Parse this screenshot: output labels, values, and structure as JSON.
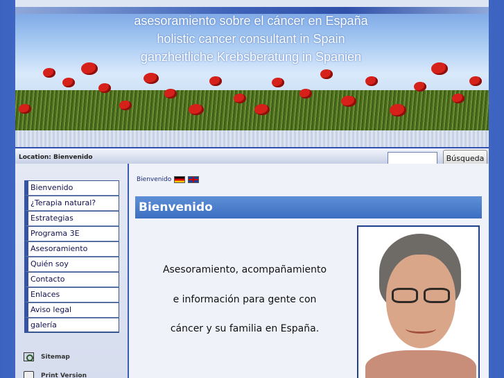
{
  "header": {
    "title_lines": [
      "asesoramiento sobre el cáncer en España",
      "holistic cancer consultant in Spain",
      "ganzheitliche Krebsberatung in Spanien"
    ]
  },
  "location": {
    "text": "Location: Bienvenido"
  },
  "search": {
    "value": "",
    "placeholder": "",
    "button_label": "Búsqueda"
  },
  "sidebar": {
    "items": [
      {
        "label": "Bienvenido"
      },
      {
        "label": "¿Terapia natural?"
      },
      {
        "label": "Estrategias"
      },
      {
        "label": "Programa 3E"
      },
      {
        "label": "Asesoramiento"
      },
      {
        "label": "Quién soy"
      },
      {
        "label": "Contacto"
      },
      {
        "label": "Enlaces"
      },
      {
        "label": "Aviso legal"
      },
      {
        "label": "galería"
      }
    ],
    "tools": [
      {
        "label": "Sitemap",
        "icon": "sitemap-icon"
      },
      {
        "label": "Print Version",
        "icon": "printer-icon"
      }
    ]
  },
  "main": {
    "breadcrumb": "Bienvenido",
    "flags": [
      "german-flag-icon",
      "uk-flag-icon"
    ],
    "heading": "Bienvenido",
    "intro_lines": [
      "Asesoramiento, acompañamiento",
      "e información para gente con",
      "cáncer y su familia en España."
    ]
  },
  "colors": {
    "accent": "#3c6ec2",
    "nav_border": "#3553a6",
    "background": "#4a72c8",
    "poppy": "#d6201a"
  }
}
